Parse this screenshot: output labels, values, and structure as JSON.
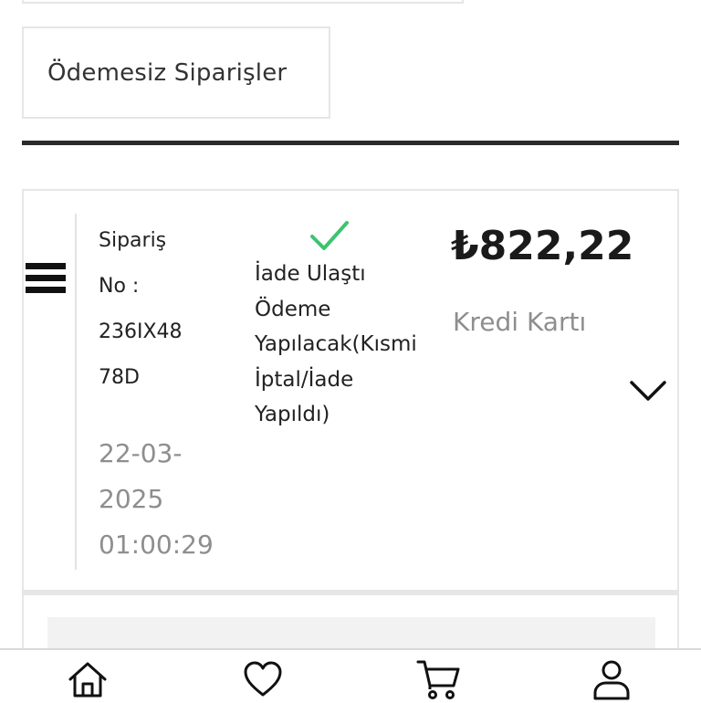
{
  "filter": {
    "label": "Ödemesiz Siparişler"
  },
  "order": {
    "number_lines": [
      "Sipariş",
      "No :",
      "236IX48",
      "78D"
    ],
    "date_lines": [
      "22-03-",
      "2025",
      "01:00:29"
    ],
    "status_lines": [
      "İade Ulaştı",
      "Ödeme",
      "Yapılacak(Kısmi",
      "İptal/İade",
      "Yapıldı)"
    ],
    "status_color": "#3cc46e",
    "amount": "₺822,22",
    "payment_method": "Kredi Kartı"
  },
  "icons": {
    "menu": "hamburger-icon",
    "status": "check-icon",
    "expand": "chevron-down-icon"
  },
  "bottom_nav": [
    {
      "name": "home",
      "icon": "home-icon"
    },
    {
      "name": "favorites",
      "icon": "heart-icon"
    },
    {
      "name": "cart",
      "icon": "cart-icon"
    },
    {
      "name": "account",
      "icon": "user-icon"
    }
  ]
}
